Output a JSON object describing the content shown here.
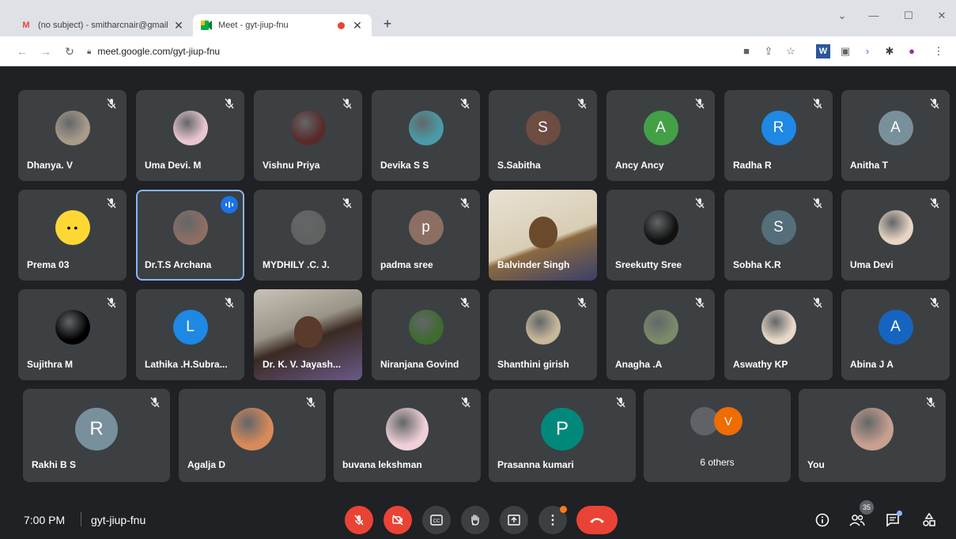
{
  "browser": {
    "tabs": [
      {
        "title": "(no subject) - smitharcnair@gmail",
        "icon": "gmail-icon"
      },
      {
        "title": "Meet - gyt-jiup-fnu",
        "icon": "meet-icon"
      }
    ],
    "url": "meet.google.com/gyt-jiup-fnu"
  },
  "participants": [
    {
      "name": "Dhanya. V",
      "avatar": "photo",
      "color": "#a89b8a"
    },
    {
      "name": "Uma Devi. M",
      "avatar": "photo",
      "color": "#e8c6d0"
    },
    {
      "name": "Vishnu Priya",
      "avatar": "photo",
      "color": "#5a2a2a"
    },
    {
      "name": "Devika S S",
      "avatar": "photo",
      "color": "#4a9ba8"
    },
    {
      "name": "S.Sabitha",
      "avatar": "S",
      "color": "#6d4c41"
    },
    {
      "name": "Ancy Ancy",
      "avatar": "A",
      "color": "#43a047"
    },
    {
      "name": "Radha R",
      "avatar": "R",
      "color": "#1e88e5"
    },
    {
      "name": "Anitha T",
      "avatar": "A",
      "color": "#78909c"
    },
    {
      "name": "Prema 03",
      "avatar": "emoji",
      "color": "#fdd835"
    },
    {
      "name": "Dr.T.S Archana",
      "avatar": "photo",
      "color": "#8d6e63"
    },
    {
      "name": "MYDHILY .C. J.",
      "avatar": "photo",
      "color": "#616161"
    },
    {
      "name": "padma sree",
      "avatar": "p",
      "color": "#8d6e63"
    },
    {
      "name": "Balvinder Singh",
      "avatar": "video",
      "color": "#d9c9a8"
    },
    {
      "name": "Sreekutty Sree",
      "avatar": "photo",
      "color": "#111111"
    },
    {
      "name": "Sobha K.R",
      "avatar": "S",
      "color": "#546e7a"
    },
    {
      "name": "Uma Devi",
      "avatar": "photo",
      "color": "#e8d5c4"
    },
    {
      "name": "Sujithra M",
      "avatar": "photo",
      "color": "#000000"
    },
    {
      "name": "Lathika .H.Subra...",
      "avatar": "L",
      "color": "#1e88e5"
    },
    {
      "name": "Dr. K. V. Jayash...",
      "avatar": "video",
      "color": "#b0a89a"
    },
    {
      "name": "Niranjana Govind",
      "avatar": "photo",
      "color": "#3e6b2f"
    },
    {
      "name": "Shanthini girish",
      "avatar": "photo",
      "color": "#c8b89a"
    },
    {
      "name": "Anagha .A",
      "avatar": "photo",
      "color": "#7a8a6a"
    },
    {
      "name": "Aswathy KP",
      "avatar": "photo",
      "color": "#e8d8c8"
    },
    {
      "name": "Abina J A",
      "avatar": "A",
      "color": "#1565c0"
    },
    {
      "name": "Rakhi B S",
      "avatar": "R",
      "color": "#78909c"
    },
    {
      "name": "Agalja D",
      "avatar": "photo",
      "color": "#d88a5a"
    },
    {
      "name": "buvana lekshman",
      "avatar": "photo",
      "color": "#f0d0d8"
    },
    {
      "name": "Prasanna kumari",
      "avatar": "P",
      "color": "#00897b"
    },
    {
      "name": "6 others",
      "avatar": "group",
      "color": "#ef6c00"
    },
    {
      "name": "You",
      "avatar": "photo",
      "color": "#c8a090"
    }
  ],
  "others_avatar_letter": "V",
  "bottom": {
    "time": "7:00 PM",
    "meeting_code": "gyt-jiup-fnu",
    "participant_count": "35"
  },
  "colors": {
    "background": "#202124",
    "tile": "#3c4043",
    "danger": "#ea4335",
    "accent": "#8ab4f8"
  }
}
